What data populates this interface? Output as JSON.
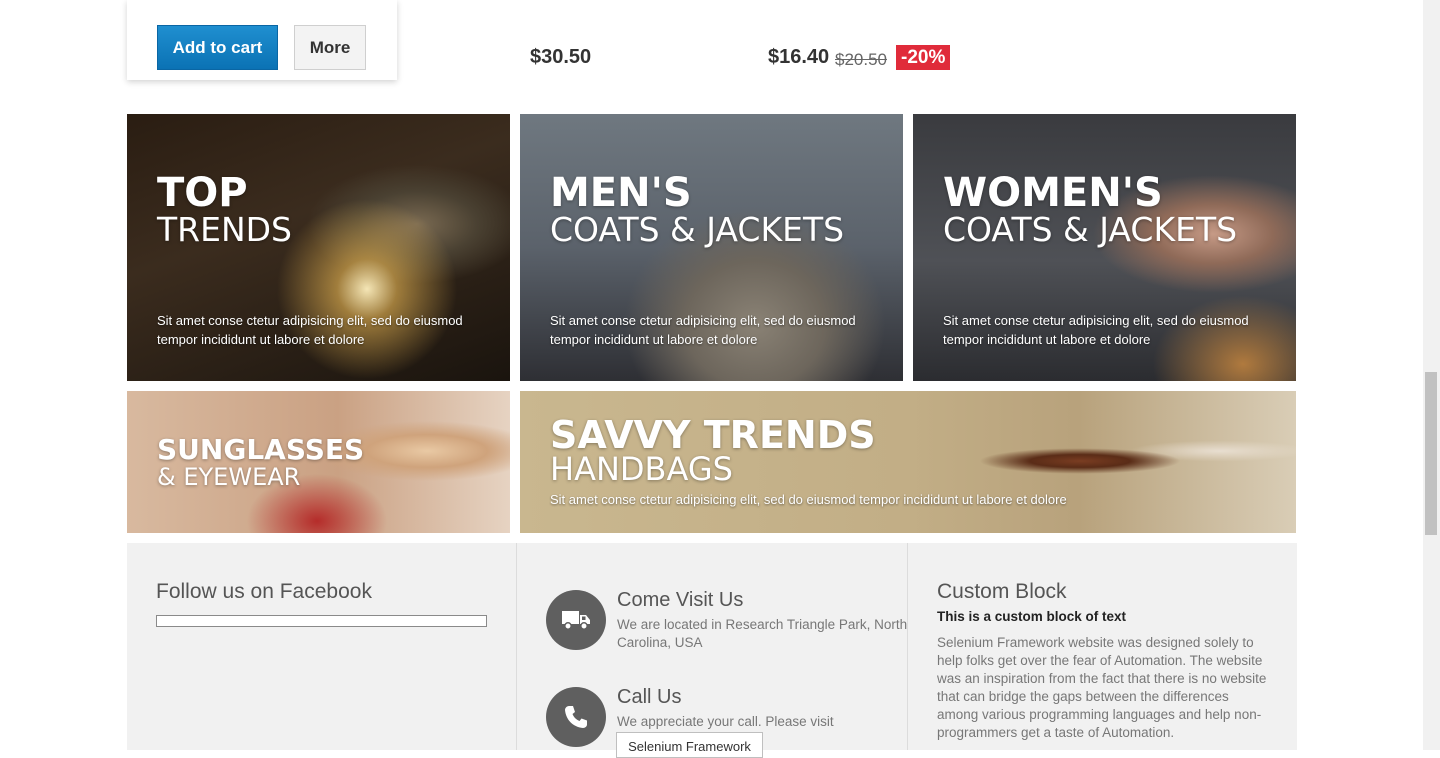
{
  "product_strip": {
    "add_to_cart_label": "Add to cart",
    "more_label": "More",
    "price_2": "$30.50",
    "price_3": "$16.40",
    "price_3_old": "$20.50",
    "discount_badge": "-20%"
  },
  "banners": {
    "top_trends": {
      "title": "TOP",
      "subtitle": "TRENDS",
      "desc_line1": "Sit amet conse ctetur adipisicing elit, sed do eiusmod",
      "desc_line2": "tempor incididunt ut labore et dolore"
    },
    "mens": {
      "title": "MEN'S",
      "subtitle": "COATS & JACKETS",
      "desc_line1": "Sit amet conse ctetur adipisicing elit, sed do eiusmod",
      "desc_line2": "tempor incididunt ut labore et dolore"
    },
    "womens": {
      "title": "WOMEN'S",
      "subtitle": "COATS & JACKETS",
      "desc_line1": "Sit amet conse ctetur adipisicing elit, sed do eiusmod",
      "desc_line2": "tempor incididunt ut labore et dolore"
    },
    "sunglasses": {
      "title": "SUNGLASSES",
      "subtitle": "& EYEWEAR"
    },
    "savvy": {
      "title": "SAVVY TRENDS",
      "subtitle": "HANDBAGS",
      "desc": "Sit amet conse ctetur adipisicing elit, sed do eiusmod tempor incididunt ut labore et dolore"
    }
  },
  "footer": {
    "facebook": {
      "heading": "Follow us on Facebook"
    },
    "visit": {
      "heading": "Come Visit Us",
      "text_line1": "We are located in Research Triangle Park, North",
      "text_line2": "Carolina, USA"
    },
    "call": {
      "heading": "Call Us",
      "text": "We appreciate your call. Please visit",
      "button_label": "Selenium Framework"
    },
    "custom": {
      "heading": "Custom Block",
      "bold": "This is a custom block of text",
      "lines": [
        "Selenium Framework website was designed solely to",
        "help folks get over the fear of Automation. The website",
        "was an inspiration from the fact that there is no website",
        "that can bridge the gaps between the differences",
        "among various programming languages and help non-",
        "programmers get a taste of Automation."
      ]
    }
  },
  "icons": {
    "visit": "truck-icon",
    "call": "phone-icon"
  },
  "colors": {
    "primary_button": "#0b72b4",
    "discount_badge": "#e02b3a",
    "footer_bg": "#f1f1f1",
    "icon_circle": "#5f5f5f"
  }
}
